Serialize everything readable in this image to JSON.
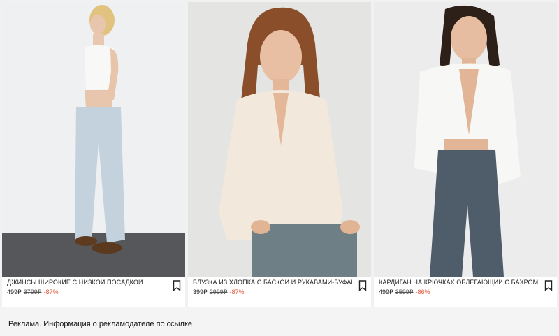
{
  "products": [
    {
      "name": "ДЖИНСЫ ШИРОКИЕ С НИЗКОЙ ПОСАДКОЙ",
      "price": "499₽",
      "old_price": "3799₽",
      "discount": "-87%",
      "image": "woman-in-white-top-and-wide-light-jeans"
    },
    {
      "name": "БЛУЗКА ИЗ ХЛОПКА С БАСКОЙ И РУКАВАМИ-БУФАМИ",
      "price": "399₽",
      "old_price": "2999₽",
      "discount": "-87%",
      "image": "woman-in-cream-cotton-blouse"
    },
    {
      "name": "КАРДИГАН НА КРЮЧКАХ ОБЛЕГАЮЩИЙ С БАХРОМОЙ",
      "price": "499₽",
      "old_price": "3599₽",
      "discount": "-86%",
      "image": "woman-in-white-fringed-cardigan-and-jeans"
    }
  ],
  "footer": {
    "ad_text": "Реклама. Информация о рекламодателе по ссылке"
  },
  "icons": {
    "bookmark": "bookmark-icon"
  },
  "colors": {
    "discount": "#e0573b",
    "text": "#1e1e1e"
  }
}
